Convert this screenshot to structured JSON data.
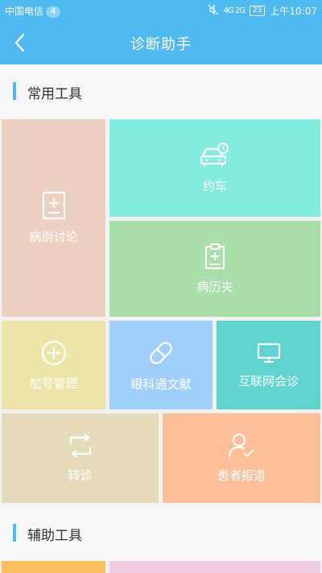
{
  "status_bar": {
    "carrier": "中国电信",
    "carrier_badge": "4",
    "signal": "4G 2G",
    "battery": "23",
    "time": "上午10:07"
  },
  "nav": {
    "title": "诊断助手",
    "back_icon": "chevron-left-icon"
  },
  "sections": {
    "common": "常用工具",
    "aux": "辅助工具"
  },
  "tiles": [
    {
      "label": "病例讨论",
      "icon": "case-document-icon",
      "color": "#ebcfc1"
    },
    {
      "label": "约车",
      "icon": "car-clock-icon",
      "color": "#84ecdf"
    },
    {
      "label": "病历夹",
      "icon": "clipboard-icon",
      "color": "#a8dfaa"
    },
    {
      "label": "加号管理",
      "icon": "plus-circle-icon",
      "color": "#ede5a8"
    },
    {
      "label": "眼科通文献",
      "icon": "pill-icon",
      "color": "#a1cffb"
    },
    {
      "label": "互联网会诊",
      "icon": "monitor-icon",
      "color": "#5fd4cf"
    },
    {
      "label": "转诊",
      "icon": "transfer-icon",
      "color": "#e5dbbb"
    },
    {
      "label": "患者报道",
      "icon": "user-check-icon",
      "color": "#fdbf97"
    }
  ],
  "aux_tile_colors": [
    "#fdbf60",
    "#f1cde3"
  ]
}
